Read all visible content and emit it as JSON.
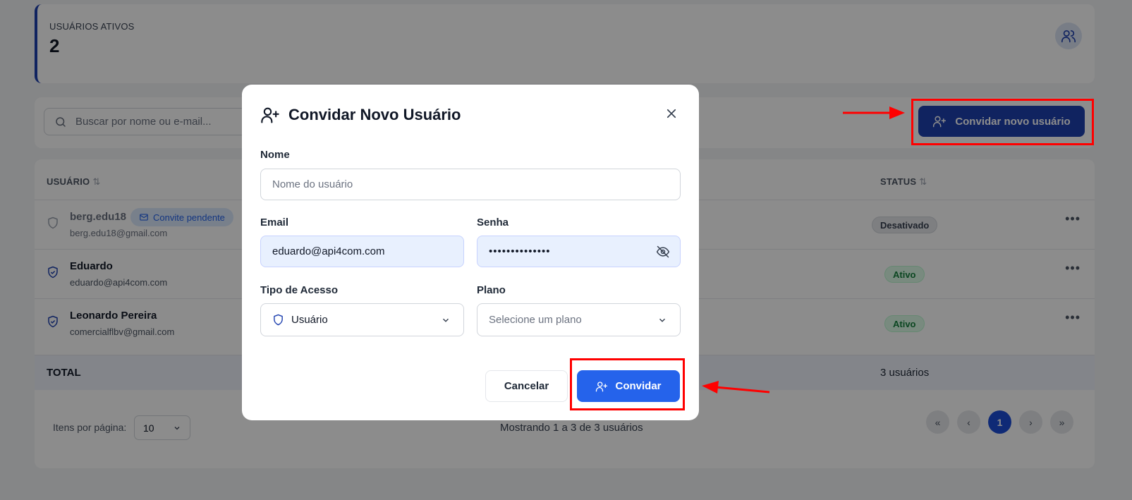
{
  "stats": {
    "active_users_label": "USUÁRIOS ATIVOS",
    "active_users_value": "2"
  },
  "toolbar": {
    "search_placeholder": "Buscar por nome ou e-mail...",
    "invite_label": "Convidar novo usuário"
  },
  "table": {
    "col_user": "USUÁRIO",
    "col_status": "STATUS",
    "sort_glyph": "⇅",
    "rows": [
      {
        "name": "berg.edu18",
        "email": "berg.edu18@gmail.com",
        "pending": "Convite pendente",
        "status": "Desativado"
      },
      {
        "name": "Eduardo",
        "email": "eduardo@api4com.com",
        "status": "Ativo"
      },
      {
        "name": "Leonardo Pereira",
        "email": "comercialflbv@gmail.com",
        "status": "Ativo"
      }
    ],
    "total_label": "TOTAL",
    "total_count": "3 usuários"
  },
  "footer": {
    "per_page_label": "Itens por página:",
    "per_page_value": "10",
    "showing": "Mostrando 1 a 3 de 3 usuários",
    "pager": [
      "«",
      "‹",
      "1",
      "›",
      "»"
    ],
    "current_page": "1"
  },
  "modal": {
    "title": "Convidar Novo Usuário",
    "name_label": "Nome",
    "name_placeholder": "Nome do usuário",
    "email_label": "Email",
    "email_value": "eduardo@api4com.com",
    "password_label": "Senha",
    "password_value": "••••••••••••••",
    "access_label": "Tipo de Acesso",
    "access_value": "Usuário",
    "plan_label": "Plano",
    "plan_placeholder": "Selecione um plano",
    "cancel_label": "Cancelar",
    "invite_label": "Convidar"
  },
  "colors": {
    "primary": "#2563eb",
    "navy": "#1e40af",
    "highlight": "#ff0000"
  }
}
